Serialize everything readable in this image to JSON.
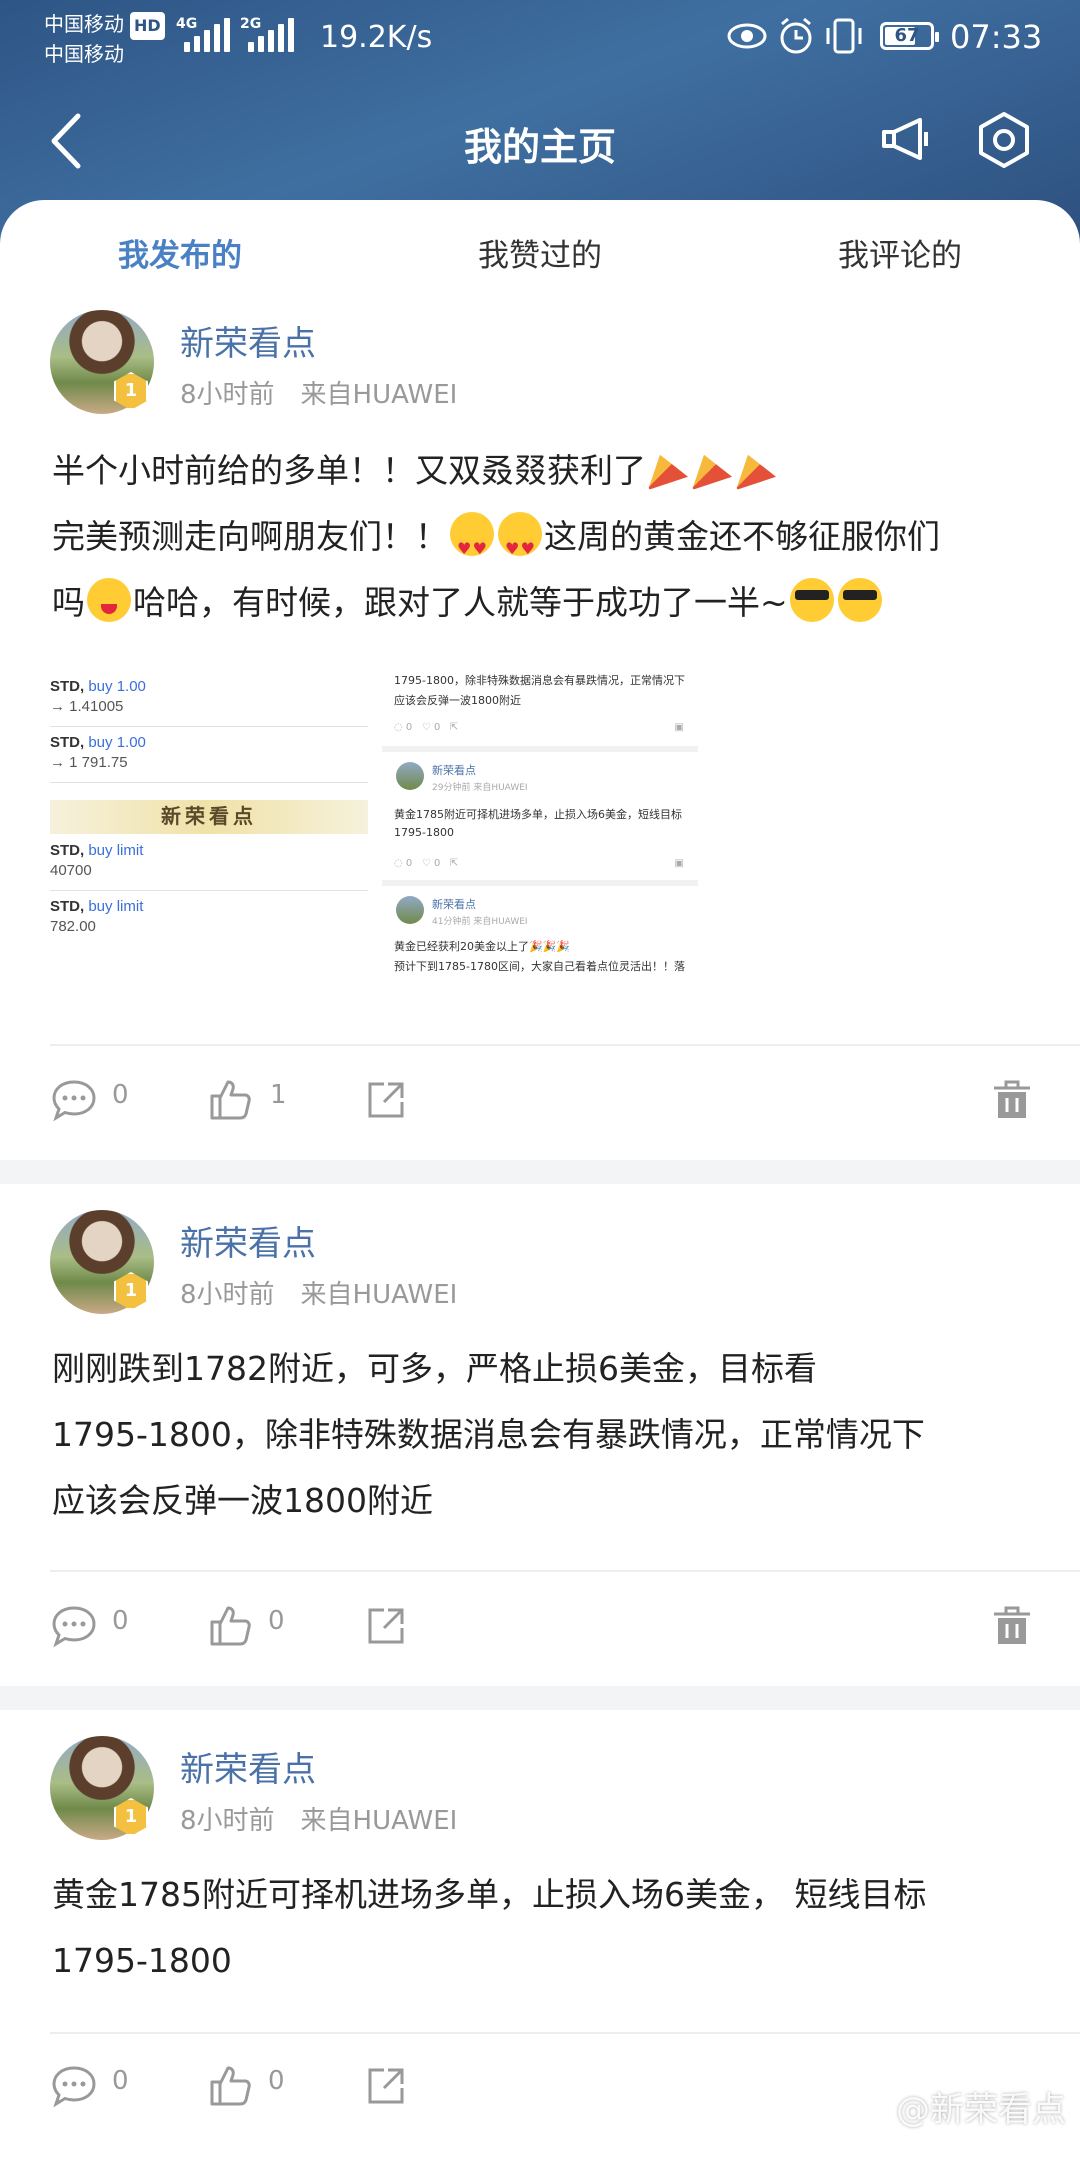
{
  "status_bar": {
    "carrier1": "中国移动",
    "carrier2": "中国移动",
    "hd": "HD",
    "net1": "4G",
    "net2": "2G",
    "speed": "19.2K/s",
    "battery": "67",
    "time": "07:33"
  },
  "nav": {
    "title": "我的主页"
  },
  "tabs": [
    {
      "label": "我发布的",
      "active": true
    },
    {
      "label": "我赞过的",
      "active": false
    },
    {
      "label": "我评论的",
      "active": false
    }
  ],
  "posts": [
    {
      "author": "新荣看点",
      "level": "1",
      "time": "8小时前",
      "source": "来自HUAWEI",
      "line1": "半个小时前给的多单！！又双叒叕获利了",
      "line2": "完美预测走向啊朋友们！！",
      "line2b": "这周的黄金还不够征服你们",
      "line3": "吗",
      "line3b": "哈哈，有时候，跟对了人就等于成功了一半~",
      "comments": "0",
      "likes": "1",
      "image_left": {
        "rows": [
          {
            "sym": "STD,",
            "action": "buy 1.00",
            "price": "→ 1.41005"
          },
          {
            "sym": "STD,",
            "action": "buy 1.00",
            "price": "→ 1 791.75"
          },
          {
            "sym": "STD,",
            "action": "buy limit",
            "price": "40700"
          },
          {
            "sym": "STD,",
            "action": "buy limit",
            "price": "782.00"
          }
        ],
        "stamp": "新荣看点"
      },
      "image_right": {
        "top_text_1": "1795-1800，除非特殊数据消息会有暴跌情况，正常情况下",
        "top_text_2": "应该会反弹一波1800附近",
        "c1": "0",
        "c2": "0",
        "name": "新荣看点",
        "meta1": "29分钟前   来自HUAWEI",
        "mid_text_1": "黄金1785附近可择机进场多单，止损入场6美金，短线目标",
        "mid_text_2": "1795-1800",
        "meta2": "41分钟前   来自HUAWEI",
        "bottom_text_1": "黄金已经获利20美金以上了🎉🎉🎉",
        "bottom_text_2": "预计下到1785-1780区间，大家自己看着点位灵活出！！落"
      }
    },
    {
      "author": "新荣看点",
      "level": "1",
      "time": "8小时前",
      "source": "来自HUAWEI",
      "line1": "刚刚跌到1782附近，可多，严格止损6美金，目标看",
      "line2": "1795-1800，除非特殊数据消息会有暴跌情况，正常情况下",
      "line3": "应该会反弹一波1800附近",
      "comments": "0",
      "likes": "0"
    },
    {
      "author": "新荣看点",
      "level": "1",
      "time": "8小时前",
      "source": "来自HUAWEI",
      "line1": "黄金1785附近可择机进场多单，止损入场6美金，  短线目标",
      "line2": "1795-1800",
      "comments": "0",
      "likes": "0"
    }
  ],
  "watermark": "@新荣看点",
  "colors": {
    "header_bg": "#3a6599",
    "accent": "#4a80c4",
    "name": "#4a72a8",
    "badge": "#f4c040"
  }
}
